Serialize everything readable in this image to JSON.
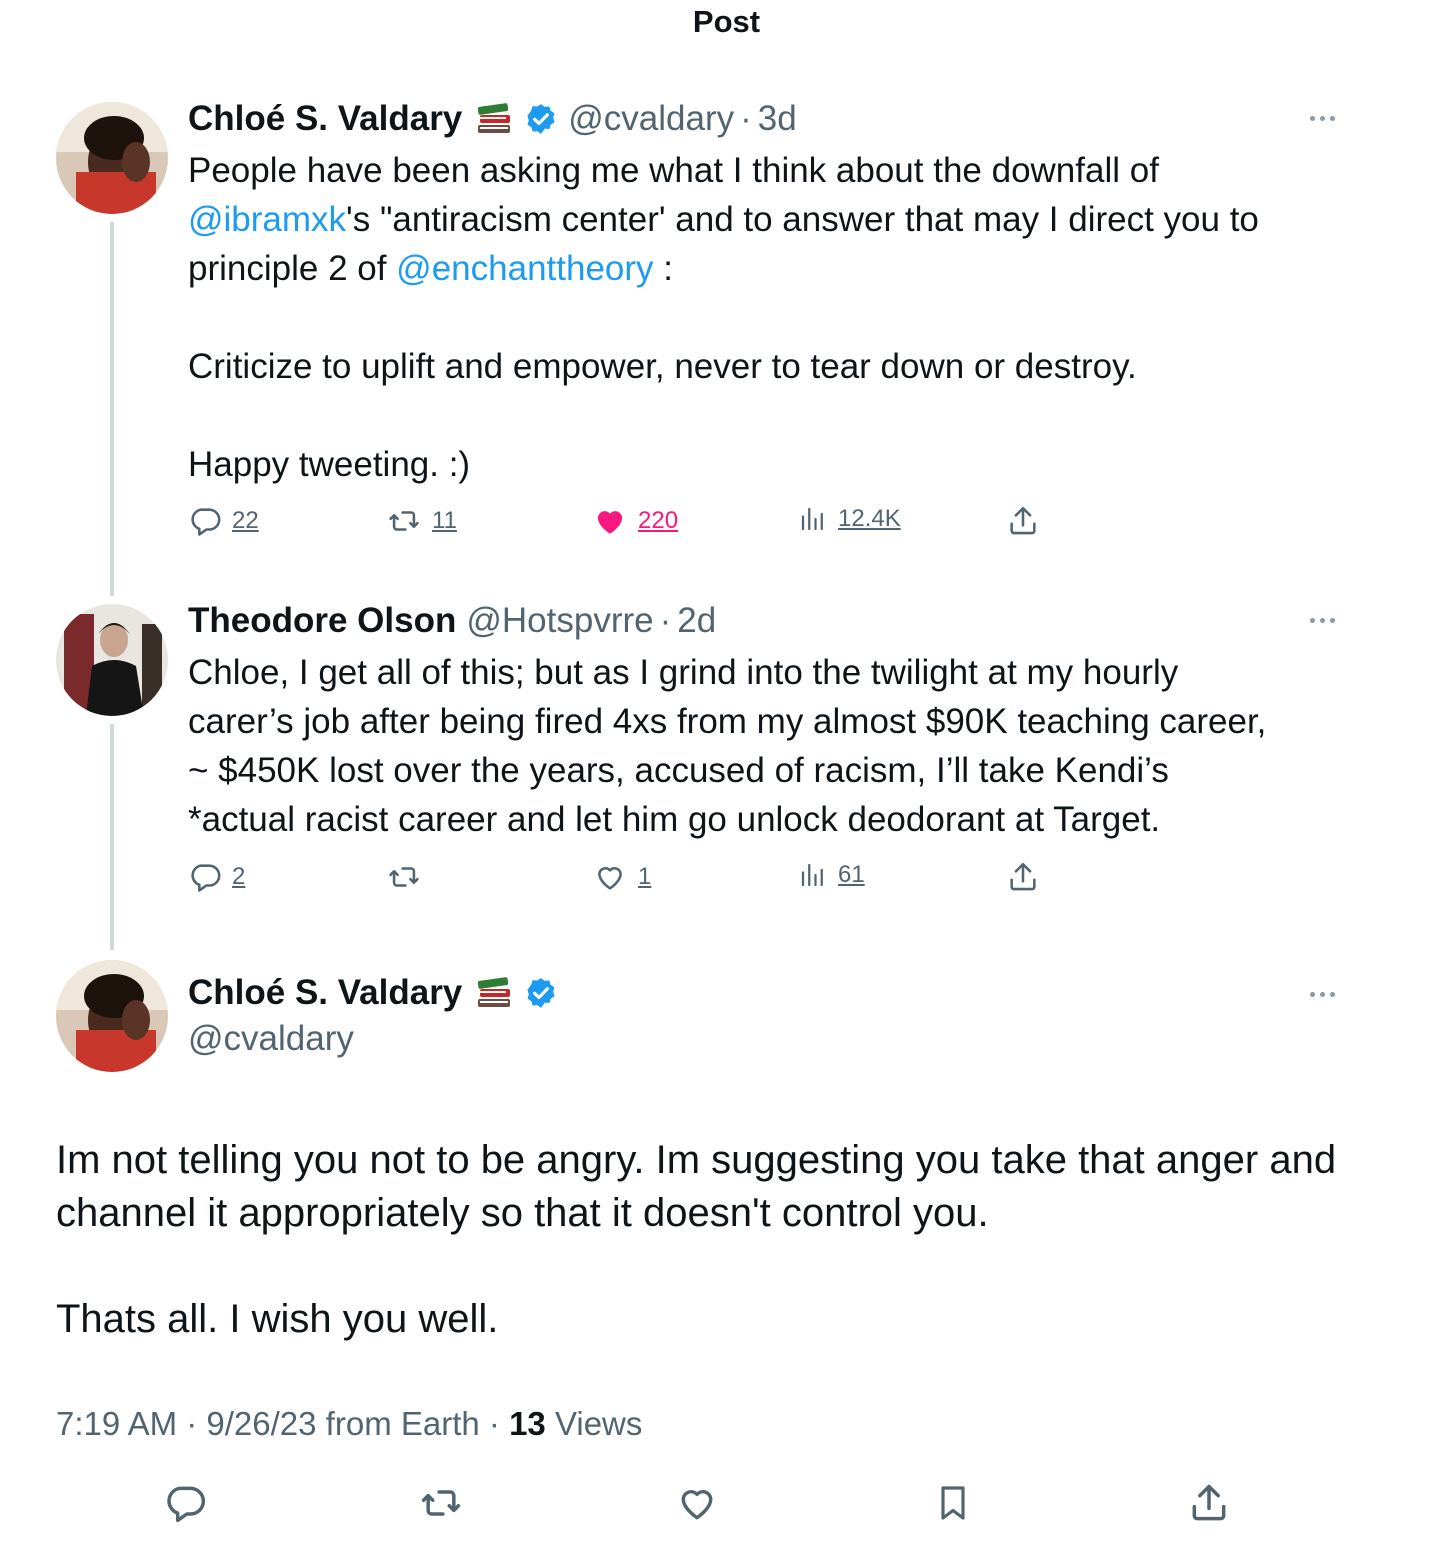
{
  "header": {
    "title": "Post"
  },
  "thread": [
    {
      "name": "Chloé S. Valdary",
      "handle": "@cvaldary",
      "separator": "·",
      "time": "3d",
      "body_parts": [
        {
          "text": "People have been asking me what I think about the downfall of\n",
          "type": "text"
        },
        {
          "text": "@ibramxk",
          "type": "mention"
        },
        {
          "text": "'s \"antiracism center' and to answer that may I direct you to\nprinciple 2 of ",
          "type": "text"
        },
        {
          "text": "@enchanttheory",
          "type": "mention"
        },
        {
          "text": " :\n\nCriticize to uplift and empower, never to tear down or destroy.\n\nHappy tweeting. :)",
          "type": "text"
        }
      ],
      "actions": {
        "replies": "22",
        "reposts": "11",
        "likes": "220",
        "views": "12.4K"
      },
      "liked": true,
      "colors": {
        "like": "#f91880"
      }
    },
    {
      "name": "Theodore Olson",
      "handle": "@Hotspvrre",
      "separator": "·",
      "time": "2d",
      "body": "Chloe, I get all of this; but as I grind into the twilight at my hourly\ncarer’s job after being fired 4xs from my almost $90K teaching career,\n~ $450K lost over the years, accused of racism, I’ll take Kendi’s\n*actual racist career and let him go unlock deodorant at Target.",
      "actions": {
        "replies": "2",
        "reposts": "",
        "likes": "1",
        "views": "61"
      },
      "liked": false
    }
  ],
  "main_post": {
    "name": "Chloé S. Valdary",
    "handle": "@cvaldary",
    "body": "Im not telling you not to be angry. Im suggesting you take that anger and\nchannel it appropriately so that it doesn't control you.\n\nThats all. I wish you well.",
    "time": "7:19 AM",
    "sep1": " · ",
    "date": "9/26/23 from Earth",
    "sep2": " · ",
    "views_count": "13",
    "views_label": " Views"
  },
  "icons": {
    "verified": "verified-badge-icon",
    "books": "books-emoji-icon",
    "reply": "reply-icon",
    "repost": "repost-icon",
    "like": "heart-icon",
    "views": "views-icon",
    "share": "share-icon",
    "bookmark": "bookmark-icon",
    "more": "more-icon"
  },
  "colors": {
    "accent": "#1d9bf0",
    "muted": "#536471",
    "text": "#0f1419",
    "like": "#f91880",
    "thread_line": "#cfd9de"
  }
}
